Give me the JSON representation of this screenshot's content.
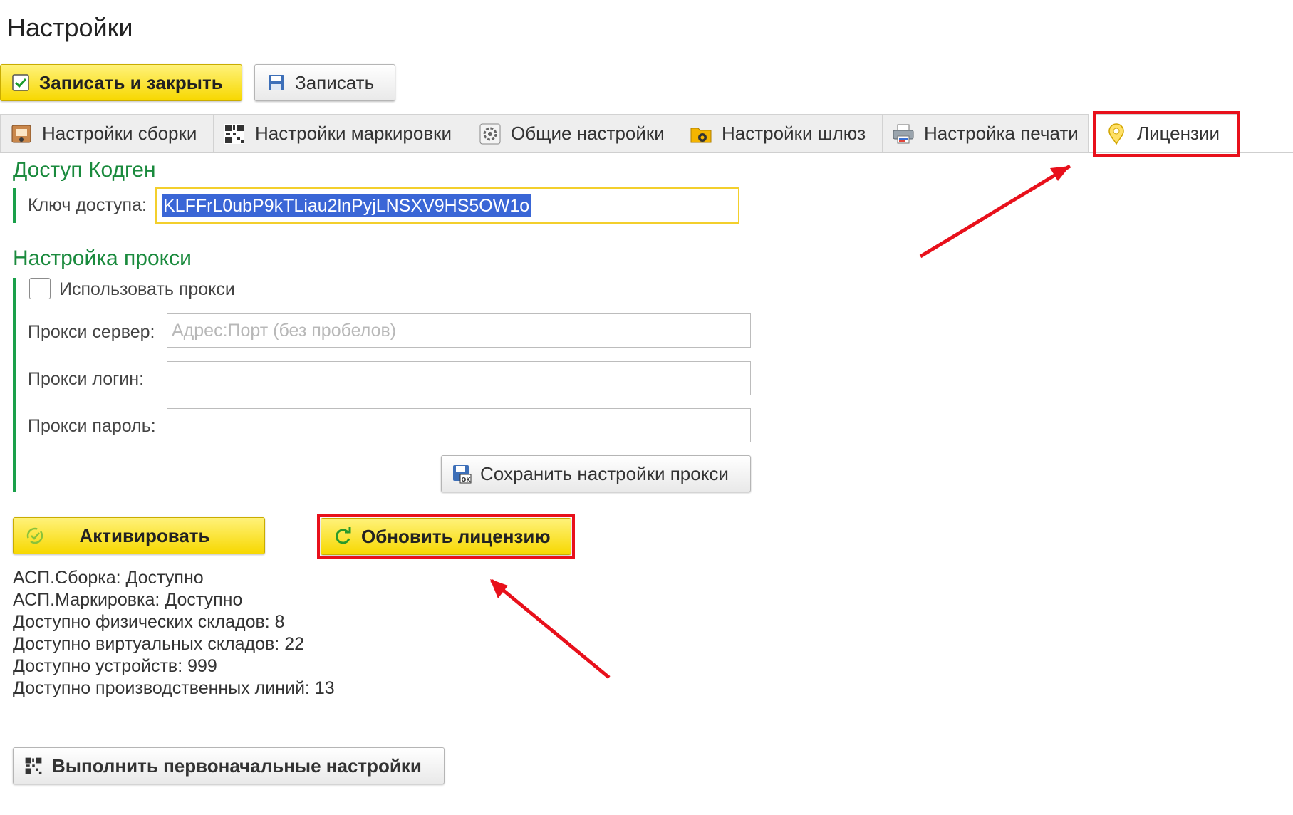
{
  "page": {
    "title": "Настройки"
  },
  "toolbar": {
    "save_close_label": "Записать и закрыть",
    "save_label": "Записать"
  },
  "tabs": [
    {
      "label": "Настройки сборки",
      "icon": "assembly-icon"
    },
    {
      "label": "Настройки маркировки",
      "icon": "qr-code-icon"
    },
    {
      "label": "Общие настройки",
      "icon": "gear-icon"
    },
    {
      "label": "Настройки шлюз",
      "icon": "folder-gear-icon"
    },
    {
      "label": "Настройка печати",
      "icon": "printer-icon"
    },
    {
      "label": "Лицензии",
      "icon": "license-badge-icon",
      "active": true
    }
  ],
  "access": {
    "title": "Доступ Кодген",
    "key_label": "Ключ доступа:",
    "key_value": "KLFFrL0ubP9kTLiau2lnPyjLNSXV9HS5OW1o"
  },
  "proxy": {
    "title": "Настройка прокси",
    "use_label": "Использовать прокси",
    "use_checked": false,
    "server_label": "Прокси сервер:",
    "server_placeholder": "Адрес:Порт (без пробелов)",
    "server_value": "",
    "login_label": "Прокси логин:",
    "login_value": "",
    "password_label": "Прокси пароль:",
    "password_value": "",
    "save_label": "Сохранить настройки прокси"
  },
  "actions": {
    "activate_label": "Активировать",
    "refresh_label": "Обновить лицензию",
    "initial_setup_label": "Выполнить первоначальные настройки"
  },
  "license_info": [
    "АСП.Сборка: Доступно",
    "АСП.Маркировка: Доступно",
    "Доступно физических складов: 8",
    "Доступно виртуальных складов: 22",
    "Доступно устройств: 999",
    "Доступно производственных линий: 13"
  ],
  "colors": {
    "accent_yellow": "#f7d800",
    "section_green": "#1a8a3d",
    "highlight_red": "#e8101b",
    "selection_blue": "#3a66d6"
  }
}
